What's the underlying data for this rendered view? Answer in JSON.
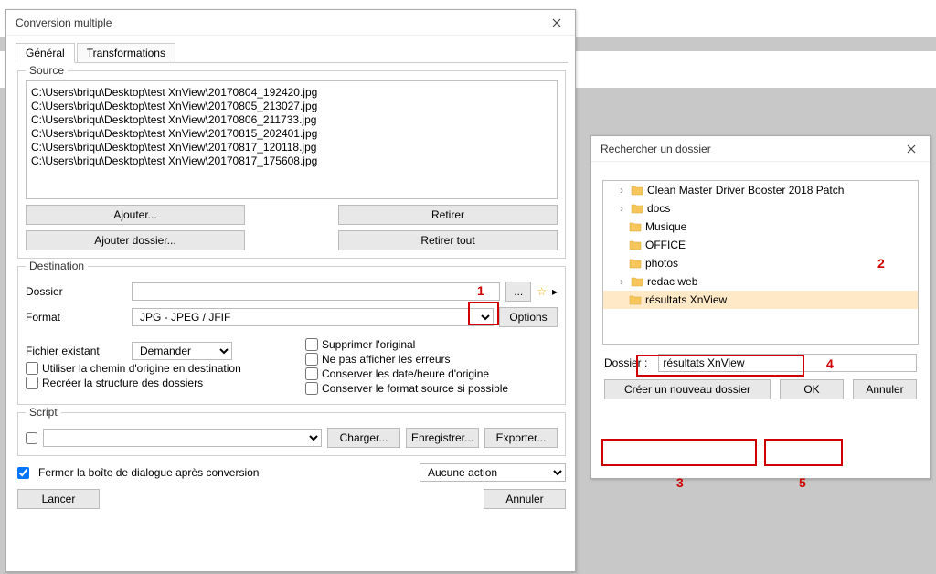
{
  "mainWindow": {
    "title": "Conversion multiple",
    "tabs": {
      "general": "Général",
      "transforms": "Transformations"
    },
    "source": {
      "legend": "Source",
      "files": [
        "C:\\Users\\briqu\\Desktop\\test XnView\\20170804_192420.jpg",
        "C:\\Users\\briqu\\Desktop\\test XnView\\20170805_213027.jpg",
        "C:\\Users\\briqu\\Desktop\\test XnView\\20170806_211733.jpg",
        "C:\\Users\\briqu\\Desktop\\test XnView\\20170815_202401.jpg",
        "C:\\Users\\briqu\\Desktop\\test XnView\\20170817_120118.jpg",
        "C:\\Users\\briqu\\Desktop\\test XnView\\20170817_175608.jpg"
      ],
      "add": "Ajouter...",
      "addFolder": "Ajouter dossier...",
      "remove": "Retirer",
      "removeAll": "Retirer tout"
    },
    "dest": {
      "legend": "Destination",
      "folderLabel": "Dossier",
      "folderValue": "",
      "browse": "...",
      "formatLabel": "Format",
      "formatValue": "JPG - JPEG / JFIF",
      "optionsBtn": "Options",
      "existingLabel": "Fichier existant",
      "existingValue": "Demander",
      "opt": {
        "deleteOriginal": "Supprimer l'original",
        "hideErrors": "Ne pas afficher les erreurs",
        "keepDate": "Conserver les date/heure d'origine",
        "useOrigPath": "Utiliser la chemin d'origine en destination",
        "recreateTree": "Recréer la structure des dossiers",
        "keepSourceFmt": "Conserver le format source si possible"
      }
    },
    "script": {
      "legend": "Script",
      "load": "Charger...",
      "save": "Enregistrer...",
      "export": "Exporter..."
    },
    "closeAfter": "Fermer la boîte de dialogue après conversion",
    "postAction": "Aucune action",
    "run": "Lancer",
    "cancel": "Annuler"
  },
  "folderWindow": {
    "title": "Rechercher un dossier",
    "items": [
      {
        "name": "Clean Master Driver Booster 2018 Patch",
        "caret": true
      },
      {
        "name": "docs",
        "caret": true
      },
      {
        "name": "Musique",
        "caret": false
      },
      {
        "name": "OFFICE",
        "caret": false
      },
      {
        "name": "photos",
        "caret": false
      },
      {
        "name": "redac web",
        "caret": true
      },
      {
        "name": "résultats XnView",
        "caret": false,
        "selected": true
      }
    ],
    "folderLabel": "Dossier :",
    "folderValue": "résultats XnView",
    "newFolder": "Créer un nouveau dossier",
    "ok": "OK",
    "cancel": "Annuler"
  },
  "annotations": {
    "a1": "1",
    "a2": "2",
    "a3": "3",
    "a4": "4",
    "a5": "5"
  }
}
